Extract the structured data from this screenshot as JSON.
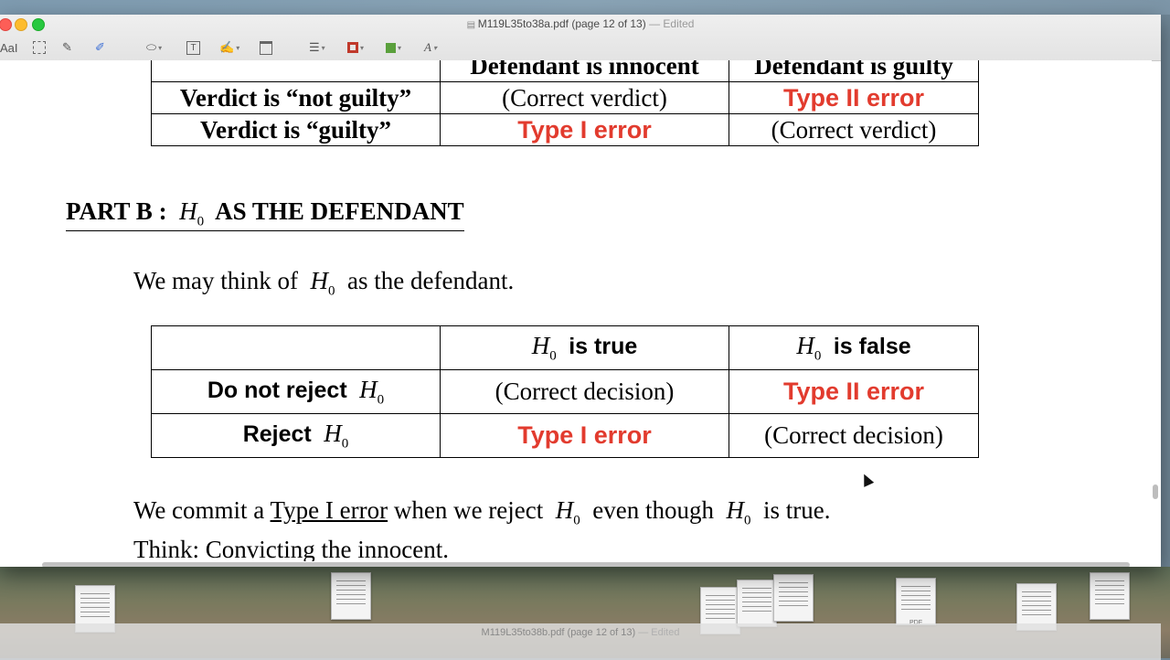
{
  "window": {
    "title": "M119L35to38a.pdf (page 12 of 13)",
    "edited": "— Edited"
  },
  "toolbar": {
    "text_tool": "AaI",
    "text_box_label": "T",
    "font_label": "A"
  },
  "document": {
    "table1": {
      "header": [
        "",
        "Defendant is innocent",
        "Defendant is guilty"
      ],
      "rows": [
        {
          "label": "Verdict is “not guilty”",
          "c1": "(Correct verdict)",
          "c2": "Type II error"
        },
        {
          "label": "Verdict is “guilty”",
          "c1": "Type I error",
          "c2": "(Correct verdict)"
        }
      ]
    },
    "heading": {
      "prefix": "PART B :",
      "var": "H",
      "sub": "0",
      "suffix": "AS THE DEFENDANT"
    },
    "intro": {
      "pre": "We may think of",
      "var": "H",
      "sub": "0",
      "post": "as the defendant."
    },
    "table2": {
      "header": [
        {
          "var": "H",
          "sub": "0",
          "text": "is true"
        },
        {
          "var": "H",
          "sub": "0",
          "text": "is false"
        }
      ],
      "rows": [
        {
          "label": "Do not reject",
          "var": "H",
          "sub": "0",
          "c1": "(Correct decision)",
          "c2": "Type II error"
        },
        {
          "label": "Reject",
          "var": "H",
          "sub": "0",
          "c1": "Type I error",
          "c2": "(Correct decision)"
        }
      ]
    },
    "line1": {
      "pre": "We commit a",
      "link": "Type I error",
      "mid": "when we reject",
      "var1": "H",
      "sub1": "0",
      "mid2": "even though",
      "var2": "H",
      "sub2": "0",
      "post": "is true."
    },
    "line2": {
      "text": "Think: Convicting the innocent."
    }
  },
  "window2": {
    "title": "M119L35to38b.pdf (page 12 of 13)",
    "edited": "— Edited"
  },
  "desktop": {
    "pdf_label": "PDF"
  },
  "colors": {
    "error_red": "#e23b2e",
    "close": "#fd5e57",
    "minimize": "#fdbc2e",
    "maximize": "#28c840",
    "border_color": "#c0392b",
    "fill_color": "#5aa03c"
  }
}
